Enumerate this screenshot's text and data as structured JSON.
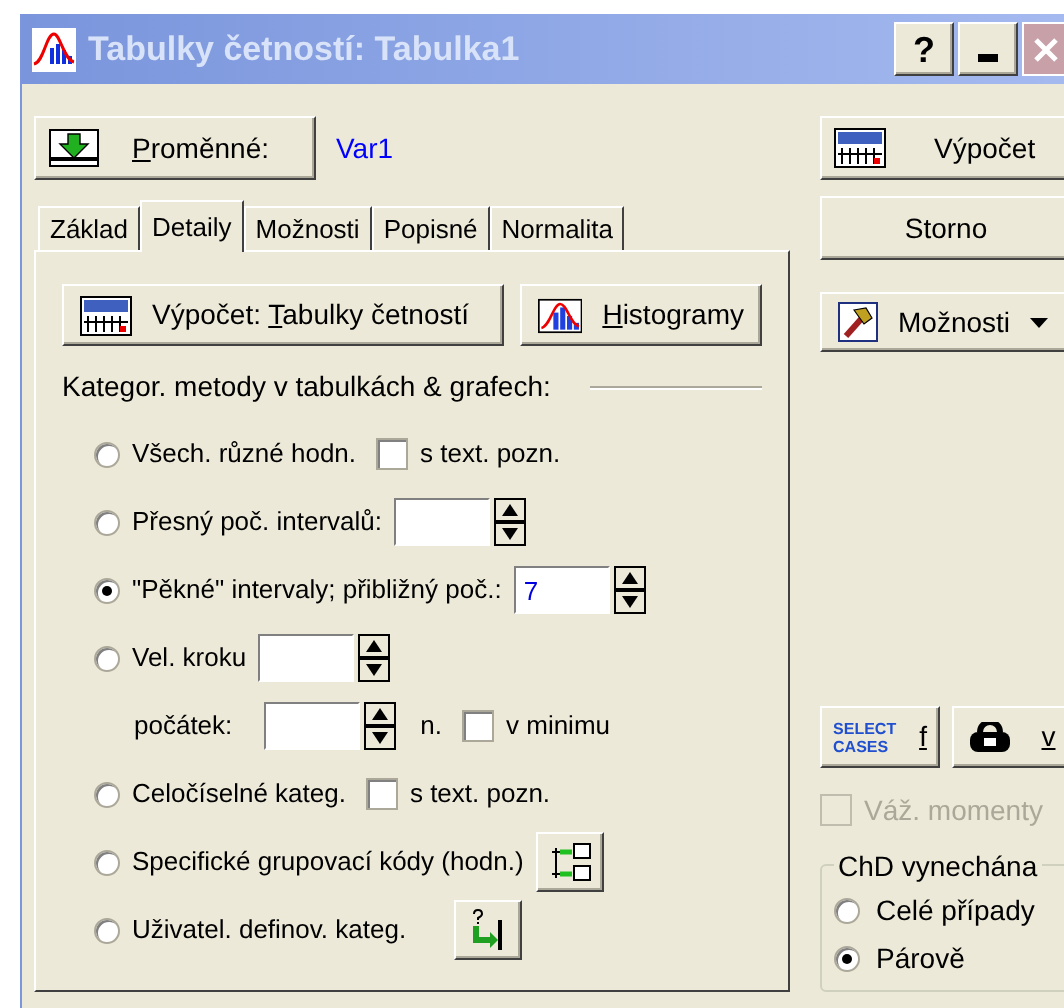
{
  "window": {
    "title": "Tabulky četností: Tabulka1",
    "help_button": "?"
  },
  "variables": {
    "button": {
      "key": "P",
      "rest": "roměnné:"
    },
    "value": "Var1"
  },
  "tabs": [
    {
      "label": "Základ",
      "selected": false
    },
    {
      "label": "Detaily",
      "selected": true
    },
    {
      "label": "Možnosti",
      "selected": false
    },
    {
      "label": "Popisné",
      "selected": false
    },
    {
      "label": "Normalita",
      "selected": false
    }
  ],
  "panel": {
    "buttons": [
      {
        "kind": "summ",
        "label": {
          "pre": "Výpočet: ",
          "key": "T",
          "rest": "abulky četností"
        }
      },
      {
        "kind": "histogram",
        "label": {
          "key": "H",
          "rest": "istogramy"
        }
      }
    ],
    "section_label": "Kategor. metody v tabulkách & grafech:",
    "rows": [
      {
        "kind": "radio",
        "selected": false,
        "label": "Všech. různé hodn.",
        "checkbox": {
          "label": "s text. pozn.",
          "checked": false
        }
      },
      {
        "kind": "radio",
        "selected": false,
        "label": "Přesný poč. intervalů:",
        "spin": {
          "kind": "number"
        }
      },
      {
        "kind": "radio",
        "selected": true,
        "label": "\"Pěkné\" intervaly; přibližný poč.:",
        "spin": {
          "kind": "number",
          "value": "7"
        }
      },
      {
        "kind": "radio",
        "selected": false,
        "label": "Vel. kroku",
        "spin": {
          "kind": "number"
        }
      },
      {
        "kind": "sub",
        "label": "počátek:",
        "spin": {
          "kind": "number"
        },
        "suffix": "n.",
        "checkbox": {
          "label": "v minimu",
          "checked": false
        }
      },
      {
        "kind": "radio",
        "selected": false,
        "label": "Celočíselné kateg.",
        "checkbox": {
          "label": "s text. pozn.",
          "checked": false
        }
      },
      {
        "kind": "radio",
        "selected": false,
        "label": "Specifické grupovací kódy (hodn.)",
        "tool": {
          "kind": "codes"
        }
      },
      {
        "kind": "radio",
        "selected": false,
        "label": "Uživatel. definov. kateg.",
        "tool": {
          "kind": "user"
        }
      }
    ]
  },
  "actions": [
    {
      "kind": "summ",
      "label": "Výpočet"
    },
    {
      "kind": "plain",
      "label": "Storno"
    }
  ],
  "options_button": {
    "label": "Možnosti"
  },
  "small_buttons": [
    {
      "kind": "select",
      "badge": "SELECT CASES",
      "label": "f"
    },
    {
      "kind": "weight",
      "label": "v"
    }
  ],
  "weights_checkbox": {
    "label": "Váž. momenty",
    "checked": false,
    "disabled": true
  },
  "missing_data": {
    "title": "ChD vynechána",
    "options": [
      {
        "label": "Celé případy",
        "selected": false
      },
      {
        "label": "Párově",
        "selected": true
      }
    ]
  }
}
